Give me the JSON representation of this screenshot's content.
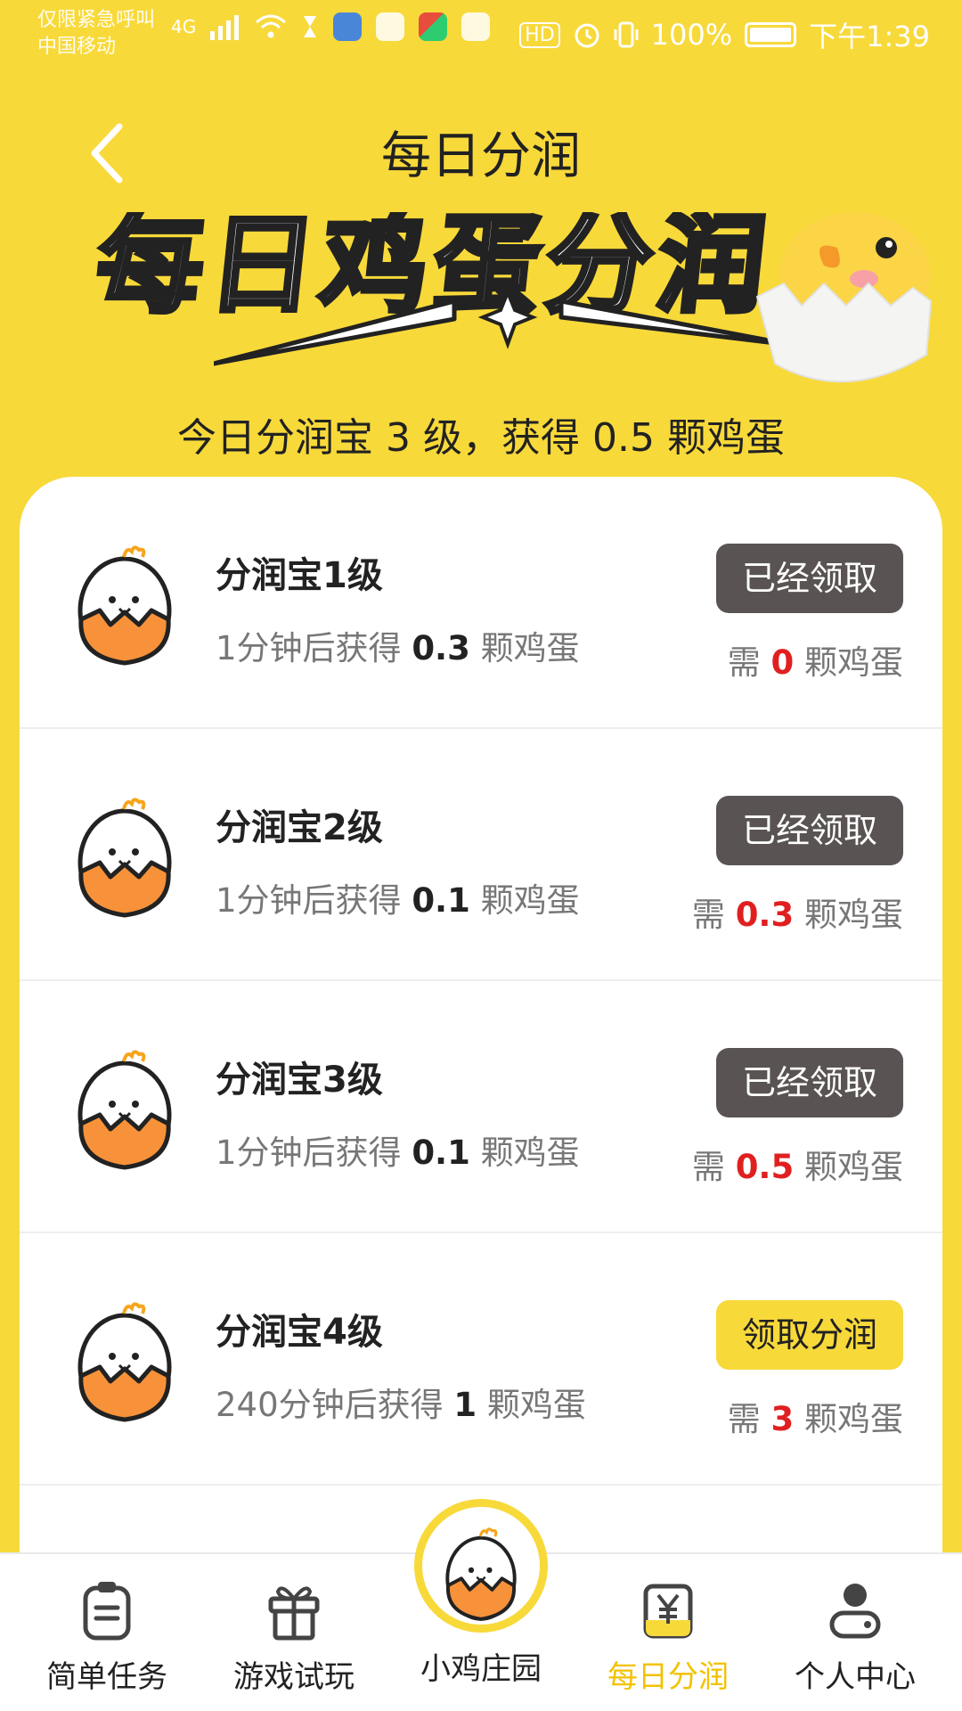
{
  "status_bar": {
    "carrier_line1": "仅限紧急呼叫",
    "carrier_line2": "中国移动",
    "network": "4G",
    "hd": "HD",
    "battery": "100%",
    "time": "下午1:39"
  },
  "header": {
    "title": "每日分润"
  },
  "banner": {
    "title": "每日鸡蛋分润"
  },
  "summary": "今日分润宝 3 级，获得 0.5 颗鸡蛋",
  "levels": [
    {
      "name": "分润宝1级",
      "desc_prefix": "1分钟后获得",
      "reward": "0.3",
      "desc_suffix": "颗鸡蛋",
      "button": "已经领取",
      "status": "done",
      "need_prefix": "需",
      "need": "0",
      "need_suffix": "颗鸡蛋"
    },
    {
      "name": "分润宝2级",
      "desc_prefix": "1分钟后获得",
      "reward": "0.1",
      "desc_suffix": "颗鸡蛋",
      "button": "已经领取",
      "status": "done",
      "need_prefix": "需",
      "need": "0.3",
      "need_suffix": "颗鸡蛋"
    },
    {
      "name": "分润宝3级",
      "desc_prefix": "1分钟后获得",
      "reward": "0.1",
      "desc_suffix": "颗鸡蛋",
      "button": "已经领取",
      "status": "done",
      "need_prefix": "需",
      "need": "0.5",
      "need_suffix": "颗鸡蛋"
    },
    {
      "name": "分润宝4级",
      "desc_prefix": "240分钟后获得",
      "reward": "1",
      "desc_suffix": "颗鸡蛋",
      "button": "领取分润",
      "status": "claim",
      "need_prefix": "需",
      "need": "3",
      "need_suffix": "颗鸡蛋"
    }
  ],
  "bottom_nav": {
    "items": [
      {
        "label": "简单任务",
        "icon": "clipboard-icon"
      },
      {
        "label": "游戏试玩",
        "icon": "gift-icon"
      },
      {
        "label": "小鸡庄园",
        "icon": "egg-icon"
      },
      {
        "label": "每日分润",
        "icon": "yuan-icon",
        "active": true
      },
      {
        "label": "个人中心",
        "icon": "person-icon"
      }
    ]
  },
  "colors": {
    "brand_yellow": "#f8d93a",
    "active_yellow": "#f2c200",
    "done_button": "#595453",
    "highlight_red": "#e02020",
    "egg_orange": "#f7923a"
  }
}
